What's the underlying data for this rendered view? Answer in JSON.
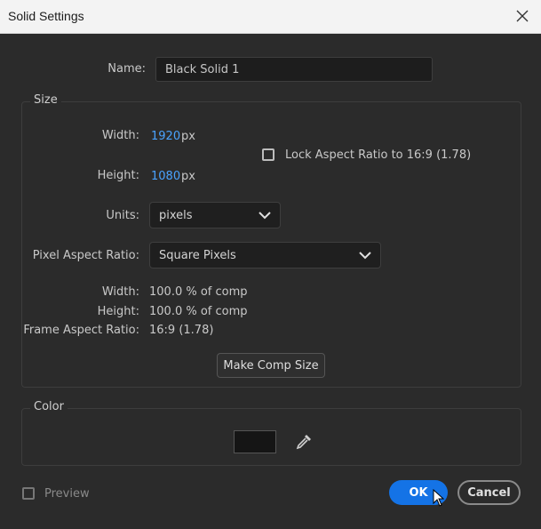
{
  "window": {
    "title": "Solid Settings"
  },
  "name_row": {
    "label": "Name:",
    "value": "Black Solid 1"
  },
  "size": {
    "group_title": "Size",
    "width_label": "Width:",
    "width_value": "1920",
    "width_unit": "px",
    "height_label": "Height:",
    "height_value": "1080",
    "height_unit": "px",
    "lock_label": "Lock Aspect Ratio to 16:9 (1.78)",
    "lock_checked": false,
    "units_label": "Units:",
    "units_value": "pixels",
    "par_label": "Pixel Aspect Ratio:",
    "par_value": "Square Pixels",
    "width_pct_label": "Width:",
    "width_pct_value": "100.0 % of comp",
    "height_pct_label": "Height:",
    "height_pct_value": "100.0 % of comp",
    "far_label": "Frame Aspect Ratio:",
    "far_value": "16:9 (1.78)",
    "make_comp_size": "Make Comp Size"
  },
  "color": {
    "group_title": "Color",
    "swatch_color": "#151515"
  },
  "footer": {
    "preview_label": "Preview",
    "preview_checked": false,
    "ok_label": "OK",
    "cancel_label": "Cancel"
  },
  "colors": {
    "accent": "#1473e6",
    "value_blue": "#4aa3ff",
    "background": "#2b2b2b"
  }
}
